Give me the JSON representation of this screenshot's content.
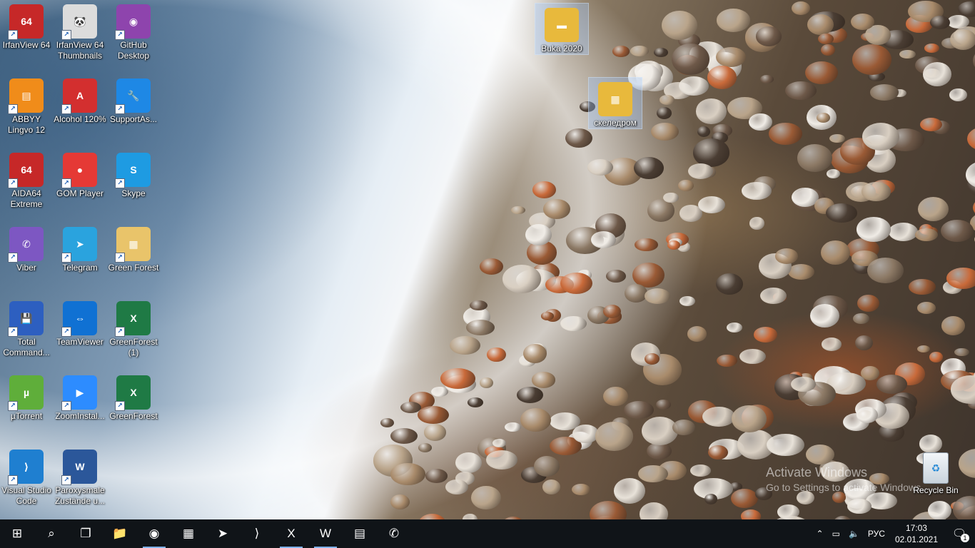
{
  "desktop": {
    "icons": [
      {
        "label": "IrfanView 64",
        "icon": "irfanview-icon",
        "color": "#c62828",
        "glyph": "64"
      },
      {
        "label": "IrfanView 64 Thumbnails",
        "icon": "panda-icon",
        "color": "#dcdcdc",
        "glyph": "🐼"
      },
      {
        "label": "GitHub Desktop",
        "icon": "github-icon",
        "color": "#8e44ad",
        "glyph": "◉"
      },
      {
        "label": "ABBYY Lingvo 12",
        "icon": "book-icon",
        "color": "#f08c1a",
        "glyph": "▤"
      },
      {
        "label": "Alcohol 120%",
        "icon": "alcohol-icon",
        "color": "#d32f2f",
        "glyph": "A"
      },
      {
        "label": "SupportAs...",
        "icon": "wrench-icon",
        "color": "#1e88e5",
        "glyph": "🔧"
      },
      {
        "label": "AIDA64 Extreme",
        "icon": "aida64-icon",
        "color": "#c62828",
        "glyph": "64"
      },
      {
        "label": "GOM Player",
        "icon": "gom-player-icon",
        "color": "#e53935",
        "glyph": "●"
      },
      {
        "label": "Skype",
        "icon": "skype-icon",
        "color": "#1e9be2",
        "glyph": "S"
      },
      {
        "label": "Viber",
        "icon": "viber-icon",
        "color": "#7d57c2",
        "glyph": "✆"
      },
      {
        "label": "Telegram",
        "icon": "telegram-icon",
        "color": "#2aa3de",
        "glyph": "➤"
      },
      {
        "label": "Green Forest",
        "icon": "folder-icon",
        "color": "#e9c46a",
        "glyph": "▦"
      },
      {
        "label": "Total Command...",
        "icon": "floppy-icon",
        "color": "#2d5fc0",
        "glyph": "💾"
      },
      {
        "label": "TeamViewer",
        "icon": "teamviewer-icon",
        "color": "#1071d3",
        "glyph": "⇔"
      },
      {
        "label": "GreenForest (1)",
        "icon": "excel-file-icon",
        "color": "#1f7a45",
        "glyph": "X"
      },
      {
        "label": "µTorrent",
        "icon": "utorrent-icon",
        "color": "#5fae3a",
        "glyph": "µ"
      },
      {
        "label": "ZoomInstal...",
        "icon": "zoom-icon",
        "color": "#2d8cff",
        "glyph": "▶"
      },
      {
        "label": "GreenForest",
        "icon": "excel-file-icon",
        "color": "#1f7a45",
        "glyph": "X"
      },
      {
        "label": "Visual Studio Code",
        "icon": "vscode-icon",
        "color": "#1f7fd0",
        "glyph": "⟩"
      },
      {
        "label": "Paroxysmale Zustände u...",
        "icon": "word-file-icon",
        "color": "#2b579a",
        "glyph": "W"
      }
    ],
    "free_icons": [
      {
        "label": "Buka 2020",
        "icon": "folder-icon",
        "color": "#e8b93c",
        "glyph": "▬"
      },
      {
        "label": "скеледром",
        "icon": "folder-icon",
        "color": "#e8b93c",
        "glyph": "▦"
      }
    ],
    "recycle_bin": {
      "label": "Recycle Bin",
      "icon": "recycle-bin-icon"
    }
  },
  "watermark": {
    "line1": "Activate Windows",
    "line2": "Go to Settings to activate Windows."
  },
  "taskbar": {
    "apps": [
      {
        "name": "start-button",
        "icon": "windows-icon",
        "glyph": "⊞"
      },
      {
        "name": "search-button",
        "icon": "search-icon",
        "glyph": "⌕"
      },
      {
        "name": "task-view-button",
        "icon": "task-view-icon",
        "glyph": "❐"
      },
      {
        "name": "file-explorer-button",
        "icon": "folder-icon",
        "glyph": "📁"
      },
      {
        "name": "chrome-button",
        "icon": "chrome-icon",
        "glyph": "◉",
        "active": true
      },
      {
        "name": "calculator-button",
        "icon": "calculator-icon",
        "glyph": "▦"
      },
      {
        "name": "telegram-button",
        "icon": "telegram-icon",
        "glyph": "➤"
      },
      {
        "name": "vscode-button",
        "icon": "vscode-icon",
        "glyph": "⟩"
      },
      {
        "name": "excel-button",
        "icon": "excel-icon",
        "glyph": "X",
        "active": true
      },
      {
        "name": "word-button",
        "icon": "word-icon",
        "glyph": "W",
        "active": true
      },
      {
        "name": "archive-button",
        "icon": "archive-icon",
        "glyph": "▤"
      },
      {
        "name": "viber-button",
        "icon": "viber-icon",
        "glyph": "✆"
      }
    ],
    "tray": {
      "chevron": "⌃",
      "language": "РУС",
      "time": "17:03",
      "date": "02.01.2021",
      "notifications": "1"
    }
  }
}
